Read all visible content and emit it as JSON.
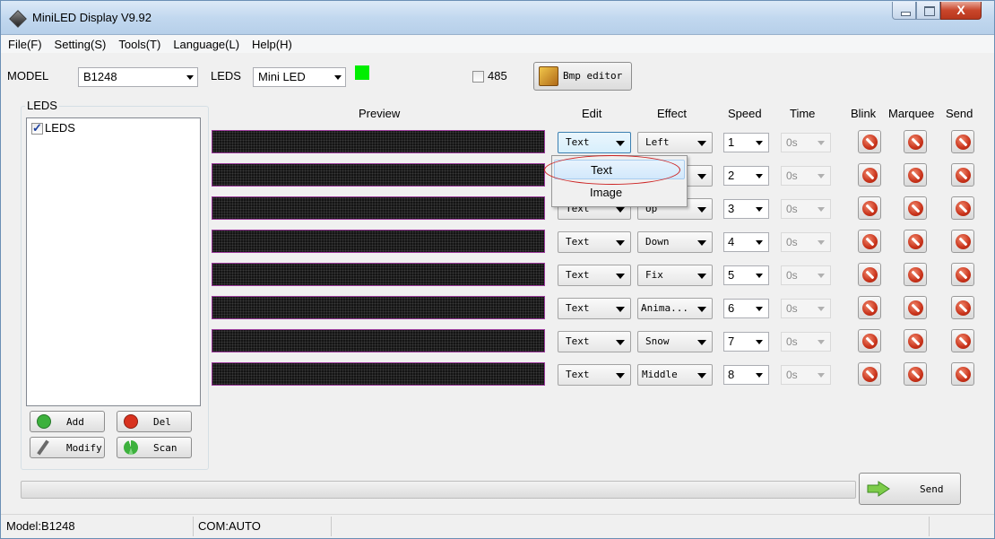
{
  "window": {
    "title": "MiniLED Display V9.92",
    "close_glyph": "X"
  },
  "menu": [
    "File(F)",
    "Setting(S)",
    "Tools(T)",
    "Language(L)",
    "Help(H)"
  ],
  "toolbar": {
    "model_label": "MODEL",
    "model_value": "B1248",
    "leds_label": "LEDS",
    "leds_value": "Mini LED",
    "indicator_color": "#00ee00",
    "checkbox_485_label": "485",
    "checkbox_485_checked": false,
    "bmp_editor_label": "Bmp editor"
  },
  "leds_panel": {
    "title": "LEDS",
    "tree_item": "LEDS",
    "tree_item_checked": true,
    "add_label": "Add",
    "del_label": "Del",
    "modify_label": "Modify",
    "scan_label": "Scan"
  },
  "columns": {
    "preview": "Preview",
    "edit": "Edit",
    "effect": "Effect",
    "speed": "Speed",
    "time": "Time",
    "blink": "Blink",
    "marquee": "Marquee",
    "send": "Send"
  },
  "rows": [
    {
      "edit": "Text",
      "effect": "Left",
      "speed": "1",
      "time": "0s"
    },
    {
      "edit": "",
      "effect": "",
      "speed": "2",
      "time": "0s"
    },
    {
      "edit": "Text",
      "effect": "Up",
      "speed": "3",
      "time": "0s"
    },
    {
      "edit": "Text",
      "effect": "Down",
      "speed": "4",
      "time": "0s"
    },
    {
      "edit": "Text",
      "effect": "Fix",
      "speed": "5",
      "time": "0s"
    },
    {
      "edit": "Text",
      "effect": "Anima...",
      "speed": "6",
      "time": "0s"
    },
    {
      "edit": "Text",
      "effect": "Snow",
      "speed": "7",
      "time": "0s"
    },
    {
      "edit": "Text",
      "effect": "Middle",
      "speed": "8",
      "time": "0s"
    }
  ],
  "edit_popup": {
    "items": [
      "Text",
      "Image"
    ],
    "selected": "Text"
  },
  "send_button_label": "Send",
  "status": {
    "model": "Model:B1248",
    "com": "COM:AUTO"
  },
  "icons": {
    "app": "diamond-app-icon",
    "bmp_editor": "paint-palette-icon",
    "add": "plus-circle-icon",
    "del": "minus-circle-icon",
    "modify": "pencil-icon",
    "scan": "refresh-icon",
    "action": "stop-icon",
    "send": "arrow-right-icon"
  },
  "colors": {
    "add_green": "#3db13d",
    "del_red": "#d8321f",
    "stop_red": "#c8321a",
    "highlight_ellipse": "#cc2222"
  }
}
